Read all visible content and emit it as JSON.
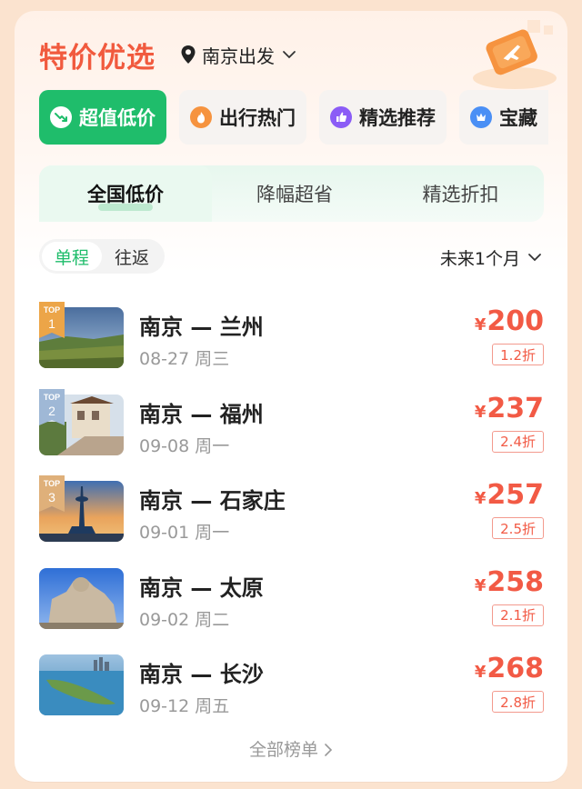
{
  "header": {
    "title": "特价优选",
    "origin": "南京出发"
  },
  "categories": [
    {
      "label": "超值低价",
      "icon": "trend-down-icon",
      "active": true
    },
    {
      "label": "出行热门",
      "icon": "fire-icon",
      "active": false
    },
    {
      "label": "精选推荐",
      "icon": "thumbs-up-icon",
      "active": false
    },
    {
      "label": "宝藏",
      "icon": "crown-icon",
      "active": false
    }
  ],
  "tabs": [
    "全国低价",
    "降幅超省",
    "精选折扣"
  ],
  "trip_types": [
    "单程",
    "往返"
  ],
  "period": "未来1个月",
  "routes": [
    {
      "rank_label": "TOP",
      "rank": "1",
      "route": "南京 — 兰州",
      "date": "08-27 周三",
      "currency": "¥",
      "price": "200",
      "discount": "1.2折"
    },
    {
      "rank_label": "TOP",
      "rank": "2",
      "route": "南京 — 福州",
      "date": "09-08 周一",
      "currency": "¥",
      "price": "237",
      "discount": "2.4折"
    },
    {
      "rank_label": "TOP",
      "rank": "3",
      "route": "南京 — 石家庄",
      "date": "09-01 周一",
      "currency": "¥",
      "price": "257",
      "discount": "2.5折"
    },
    {
      "route": "南京 — 太原",
      "date": "09-02 周二",
      "currency": "¥",
      "price": "258",
      "discount": "2.1折"
    },
    {
      "route": "南京 — 长沙",
      "date": "09-12 周五",
      "currency": "¥",
      "price": "268",
      "discount": "2.8折"
    }
  ],
  "footer": {
    "all_label": "全部榜单"
  },
  "colors": {
    "accent": "#1fbd6b",
    "price": "#f25a45",
    "title": "#f15a3e"
  }
}
